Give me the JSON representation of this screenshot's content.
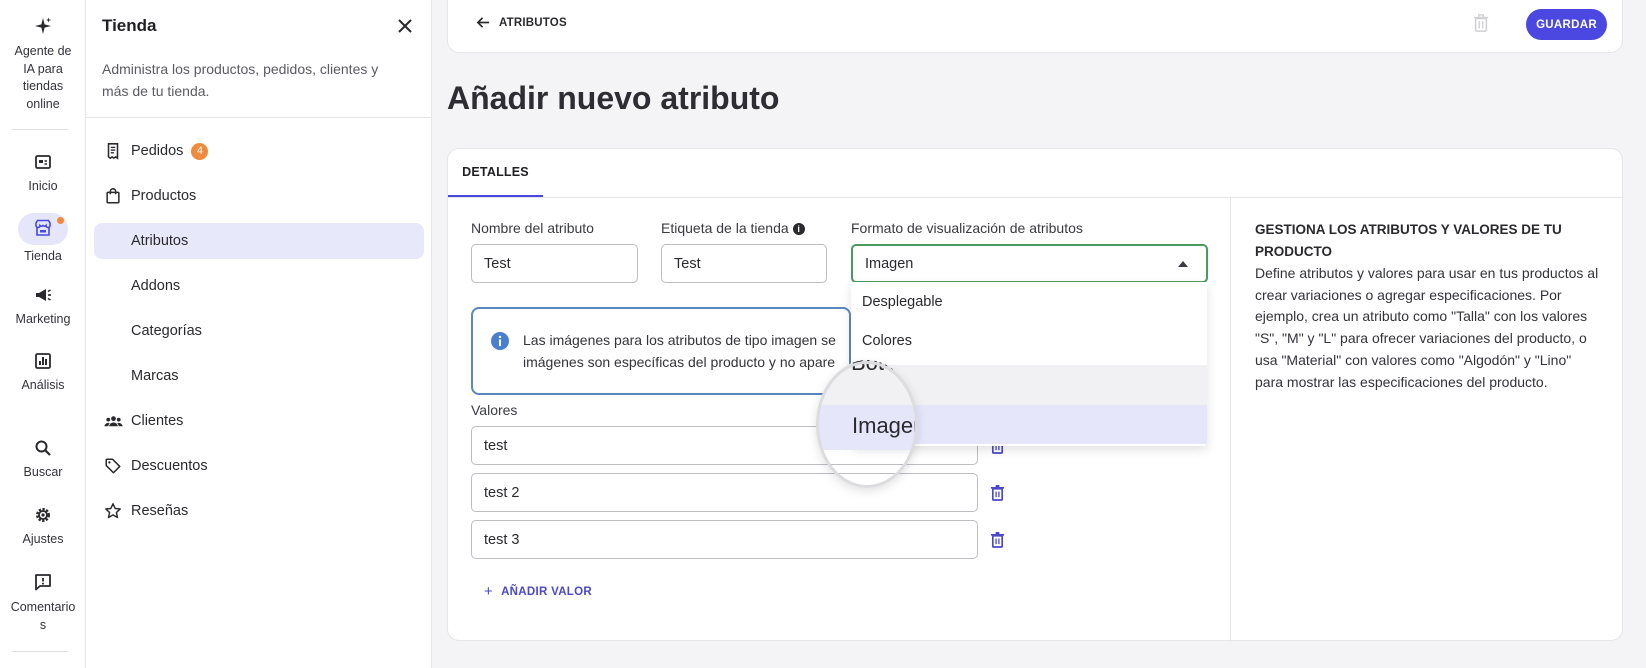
{
  "rail": {
    "items": [
      {
        "label": "Agente de IA para tiendas online",
        "icon": "sparkle-icon"
      },
      {
        "label": "Inicio",
        "icon": "home-icon"
      },
      {
        "label": "Tienda",
        "icon": "store-icon"
      },
      {
        "label": "Marketing",
        "icon": "megaphone-icon"
      },
      {
        "label": "Análisis",
        "icon": "chart-icon"
      },
      {
        "label": "Buscar",
        "icon": "search-icon"
      },
      {
        "label": "Ajustes",
        "icon": "gear-icon"
      },
      {
        "label": "Comentarios",
        "icon": "feedback-icon"
      }
    ]
  },
  "panel": {
    "title": "Tienda",
    "description": "Administra los productos, pedidos, clientes y más de tu tienda.",
    "nav": [
      {
        "label": "Pedidos",
        "badge": "4"
      },
      {
        "label": "Productos"
      },
      {
        "label": "Atributos"
      },
      {
        "label": "Addons"
      },
      {
        "label": "Categorías"
      },
      {
        "label": "Marcas"
      },
      {
        "label": "Clientes"
      },
      {
        "label": "Descuentos"
      },
      {
        "label": "Reseñas"
      }
    ]
  },
  "topbar": {
    "back_label": "ATRIBUTOS",
    "save_label": "GUARDAR"
  },
  "page": {
    "title": "Añadir nuevo atributo",
    "tab": "DETALLES"
  },
  "form": {
    "name_label": "Nombre del atributo",
    "name_value": "Test",
    "store_label": "Etiqueta de la tienda",
    "store_value": "Test",
    "format_label": "Formato de visualización de atributos",
    "format_value": "Imagen",
    "info_text_1": "Las imágenes para los atributos de tipo imagen se",
    "info_text_2": "imágenes son específicas del producto y no apare",
    "values_label": "Valores",
    "values": [
      "test",
      "test 2",
      "test 3"
    ],
    "add_value_label": "AÑADIR VALOR"
  },
  "dropdown": {
    "options": [
      "Desplegable",
      "Colores",
      "Botón",
      "Imagen"
    ],
    "selected": "Imagen"
  },
  "help": {
    "title": "GESTIONA LOS ATRIBUTOS Y VALORES DE TU PRODUCTO",
    "body": "Define atributos y valores para usar en tus productos al crear variaciones o agregar especificaciones. Por ejemplo, crea un atributo como \"Talla\" con los valores \"S\", \"M\" y \"L\" para ofrecer variaciones del producto, o usa \"Material\" con valores como \"Algodón\" y \"Lino\" para mostrar las especificaciones del producto."
  },
  "colors": {
    "accent": "#4a48e0",
    "badge": "#f08a3c",
    "active_bg": "#e8e8fb",
    "select_border": "#4c9a5e"
  }
}
